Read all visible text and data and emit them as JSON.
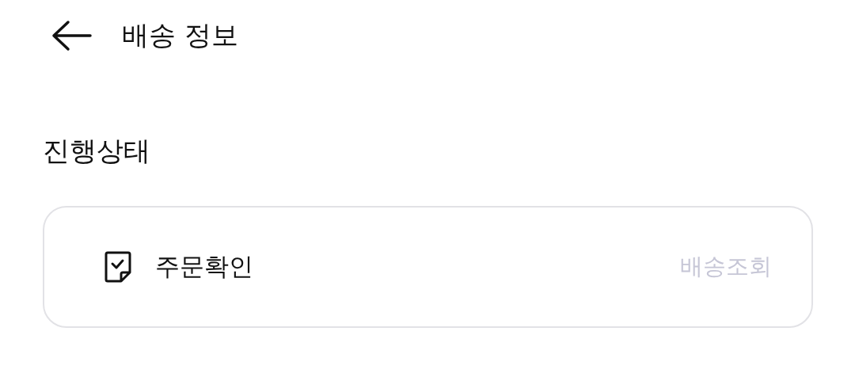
{
  "header": {
    "title": "배송 정보"
  },
  "section": {
    "title": "진행상태"
  },
  "status_card": {
    "status": "주문확인",
    "action": "배송조회"
  }
}
